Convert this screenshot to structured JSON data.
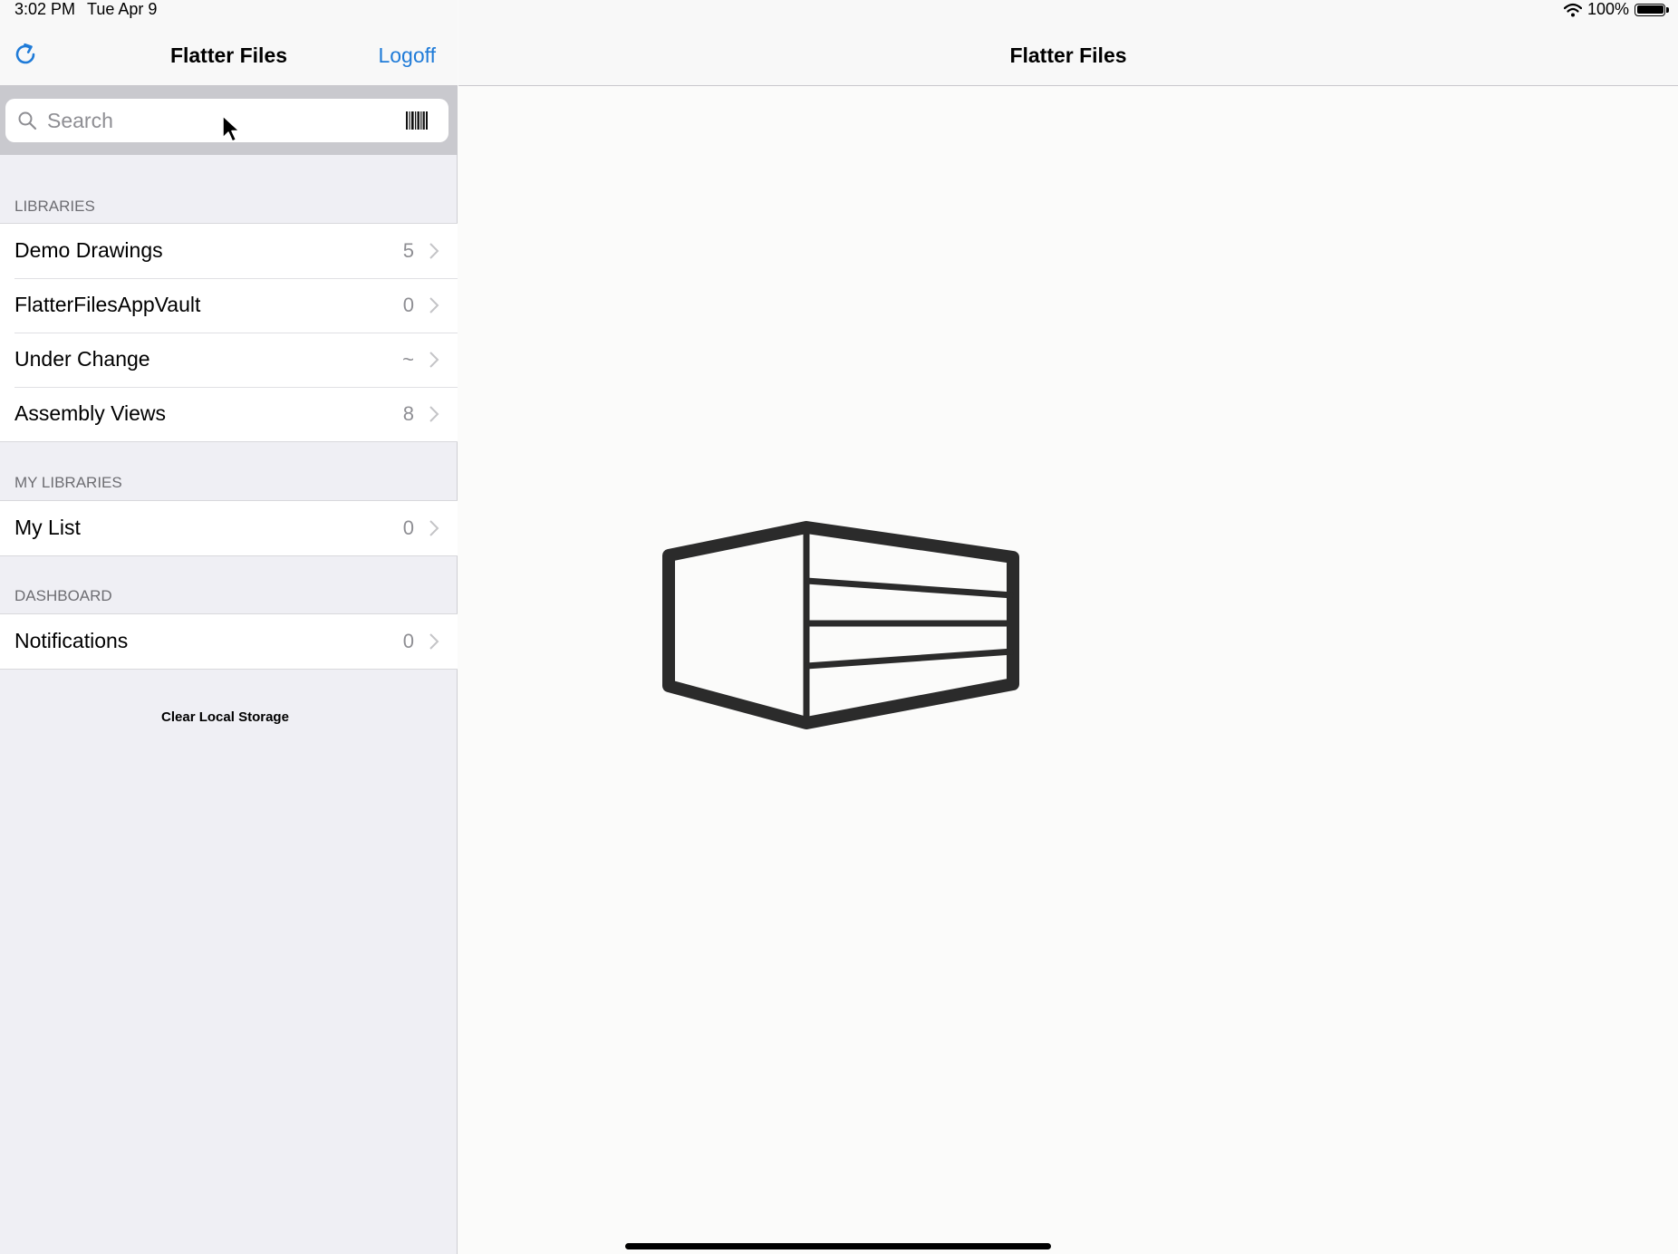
{
  "status_bar": {
    "time": "3:02 PM",
    "date": "Tue Apr 9",
    "battery": "100%",
    "icons": [
      "wifi-icon",
      "battery-icon"
    ]
  },
  "master": {
    "title": "Flatter Files",
    "logoff_label": "Logoff",
    "refresh_icon": "refresh-icon",
    "search": {
      "placeholder": "Search",
      "value": "",
      "icons": [
        "search-icon",
        "barcode-icon"
      ]
    },
    "sections": [
      {
        "header": "LIBRARIES",
        "items": [
          {
            "label": "Demo Drawings",
            "count": "5"
          },
          {
            "label": "FlatterFilesAppVault",
            "count": "0"
          },
          {
            "label": "Under Change",
            "count": "~"
          },
          {
            "label": "Assembly Views",
            "count": "8"
          }
        ]
      },
      {
        "header": "MY LIBRARIES",
        "items": [
          {
            "label": "My List",
            "count": "0"
          }
        ]
      },
      {
        "header": "DASHBOARD",
        "items": [
          {
            "label": "Notifications",
            "count": "0"
          }
        ]
      }
    ],
    "clear_storage_label": "Clear Local Storage"
  },
  "detail": {
    "title": "Flatter Files",
    "logo": "flatter-files-logo"
  },
  "colors": {
    "accent": "#1f7bd8",
    "sidebar_bg": "#efeff4",
    "detail_bg": "#fbfbfa",
    "logo": "#2b2b2b"
  }
}
